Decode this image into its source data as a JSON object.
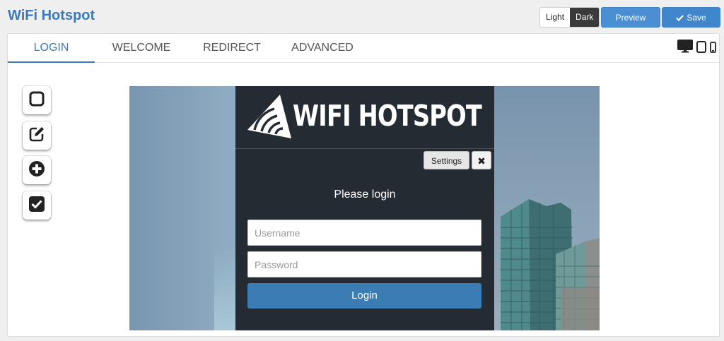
{
  "app": {
    "title": "WiFi Hotspot"
  },
  "toolbar": {
    "theme_light": "Light",
    "theme_dark": "Dark",
    "preview_label": "Preview",
    "save_label": "Save"
  },
  "tabs": [
    {
      "label": "LOGIN",
      "active": true
    },
    {
      "label": "WELCOME",
      "active": false
    },
    {
      "label": "REDIRECT",
      "active": false
    },
    {
      "label": "ADVANCED",
      "active": false
    }
  ],
  "devices": [
    "desktop-icon",
    "tablet-icon",
    "phone-icon"
  ],
  "tools": [
    "square-icon",
    "edit-icon",
    "plus-circle-icon",
    "checkbox-icon"
  ],
  "preview": {
    "logo_text": "WIFI HOTSPOT",
    "settings_label": "Settings",
    "heading": "Please login",
    "username_placeholder": "Username",
    "password_placeholder": "Password",
    "login_label": "Login"
  },
  "colors": {
    "accent": "#3a7ab8",
    "panel_dark": "#252b33",
    "login_button": "#3b7cb4"
  }
}
